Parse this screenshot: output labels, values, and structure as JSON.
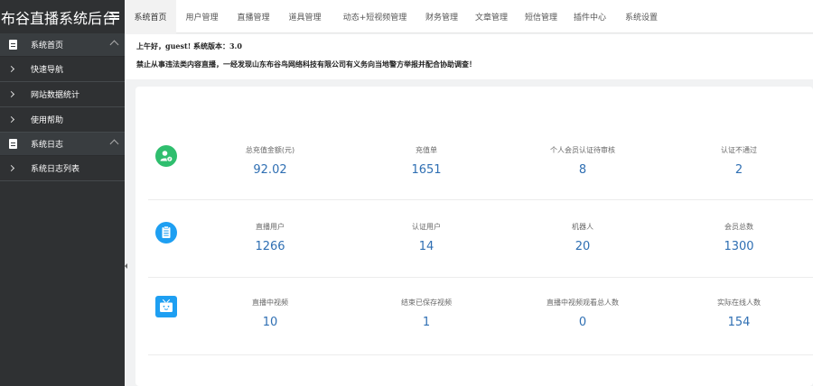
{
  "brand": {
    "title": "布谷直播系统后台"
  },
  "sidebar": {
    "groups": [
      {
        "label": "系统首页",
        "items": [
          {
            "label": "快速导航"
          },
          {
            "label": "网站数据统计"
          },
          {
            "label": "使用帮助"
          }
        ]
      },
      {
        "label": "系统日志",
        "items": [
          {
            "label": "系统日志列表"
          }
        ]
      }
    ]
  },
  "topnav": {
    "tabs": [
      {
        "label": "系统首页",
        "active": true
      },
      {
        "label": "用户管理"
      },
      {
        "label": "直播管理"
      },
      {
        "label": "道具管理"
      },
      {
        "label": "动态+短视频管理"
      },
      {
        "label": "财务管理"
      },
      {
        "label": "文章管理"
      },
      {
        "label": "短信管理"
      },
      {
        "label": "插件中心"
      },
      {
        "label": "系统设置"
      }
    ]
  },
  "notice": {
    "greeting": "上午好，guest! 系统版本：3.0",
    "warning": "禁止从事违法类内容直播，一经发现山东布谷鸟网络科技有限公司有义务向当地警方举报并配合协助调查！"
  },
  "stats": {
    "rows": [
      {
        "icon": "user-money-icon",
        "icon_color": "#2fbe6e",
        "items": [
          {
            "label": "总充值金额(元)",
            "value": "92.02"
          },
          {
            "label": "充值单",
            "value": "1651"
          },
          {
            "label": "个人会员认证待审核",
            "value": "8"
          },
          {
            "label": "认证不通过",
            "value": "2"
          }
        ]
      },
      {
        "icon": "clipboard-icon",
        "icon_color": "#1e9ff2",
        "items": [
          {
            "label": "直播用户",
            "value": "1266"
          },
          {
            "label": "认证用户",
            "value": "14"
          },
          {
            "label": "机器人",
            "value": "20"
          },
          {
            "label": "会员总数",
            "value": "1300"
          }
        ]
      },
      {
        "icon": "tv-icon",
        "icon_color": "#1e9ff2",
        "items": [
          {
            "label": "直播中视频",
            "value": "10"
          },
          {
            "label": "结束已保存视频",
            "value": "1"
          },
          {
            "label": "直播中视频观看总人数",
            "value": "0"
          },
          {
            "label": "实际在线人数",
            "value": "154"
          }
        ]
      }
    ]
  }
}
